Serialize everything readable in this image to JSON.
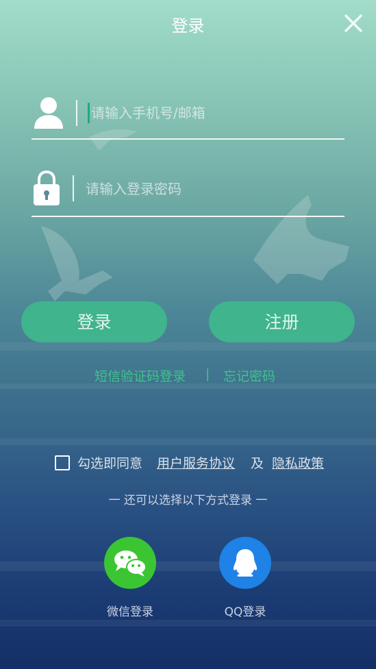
{
  "header": {
    "title": "登录",
    "close_icon": "close-icon"
  },
  "login_form": {
    "account_placeholder": "请输入手机号/邮箱",
    "password_placeholder": "请输入登录密码",
    "user_icon": "user-icon",
    "lock_icon": "lock-icon"
  },
  "actions": {
    "login_label": "登录",
    "register_label": "注册",
    "sms_login_link": "短信验证码登录",
    "link_separator": "|",
    "forgot_password_link": "忘记密码"
  },
  "agreement": {
    "checked": false,
    "prefix": "勾选即同意",
    "user_agreement_link": "用户服务协议",
    "conjunction": "及",
    "privacy_policy_link": "隐私政策"
  },
  "third_party": {
    "divider_text": "一 还可以选择以下方式登录 一",
    "wechat_label": "微信登录",
    "qq_label": "QQ登录"
  },
  "colors": {
    "accent_green": "#3fb48d",
    "link_green": "#3ec48a",
    "wechat_green": "#3cc533",
    "qq_blue": "#1e82e6"
  }
}
